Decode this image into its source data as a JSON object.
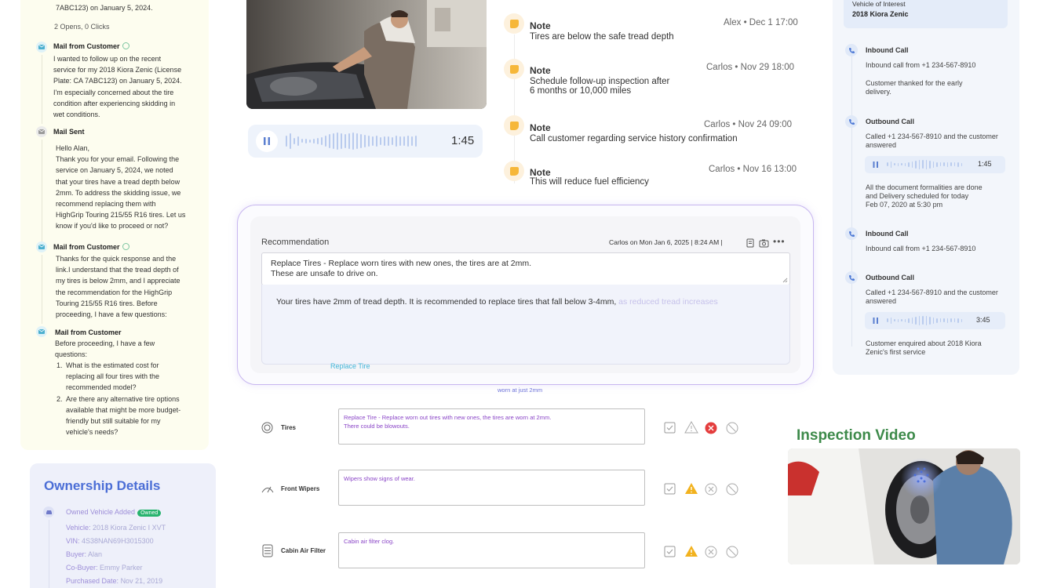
{
  "email_thread": {
    "top_snippet": "7ABC123) on January 5, 2024.",
    "stats": "2 Opens, 0 Clicks",
    "mails": [
      {
        "title": "Mail from Customer",
        "lines": [
          "I wanted to follow up on the recent",
          "service for my 2018 Kiora Zenic (License",
          "Plate: CA 7ABC123) on January 5, 2024.",
          "I'm especially concerned about the tire",
          "condition after experiencing skidding in",
          "wet conditions."
        ]
      },
      {
        "title": "Mail Sent",
        "lines": [
          "Hello Alan,",
          "Thank you for your email. Following the",
          "service on January 5, 2024, we noted",
          "that your tires have a tread depth below",
          "2mm. To address the skidding issue, we",
          "recommend replacing them with",
          "HighGrip Touring 215/55 R16 tires. Let us",
          "know if you'd like to proceed or not?"
        ]
      },
      {
        "title": "Mail from Customer",
        "lines": [
          "Thanks for the quick response and the",
          "link.I understand that the tread depth of",
          "my tires is below 2mm, and I appreciate",
          "the recommendation for the HighGrip",
          "Touring 215/55 R16 tires. Before",
          "proceeding, I have a few questions:"
        ]
      },
      {
        "title": "Mail from Customer",
        "intro": [
          "Before proceeding, I have a few",
          "questions:"
        ],
        "list": [
          [
            "1.",
            "What is the estimated cost for",
            "replacing all four tires with the",
            "recommended model?"
          ],
          [
            "2.",
            "Are there any alternative tire options",
            "available that might be more budget-",
            "friendly but still suitable for my",
            "vehicle's needs?"
          ]
        ]
      }
    ]
  },
  "ownership": {
    "title": "Ownership Details",
    "added_label": "Owned Vehicle Added",
    "badge": "Owned",
    "rows": [
      {
        "k": "Vehicle:",
        "v": "2018 Kiora Zenic I XVT"
      },
      {
        "k": "VIN:",
        "v": "4S38NAN69H3015300"
      },
      {
        "k": "Buyer:",
        "v": "Alan"
      },
      {
        "k": "Co-Buyer:",
        "v": "Emmy Parker"
      },
      {
        "k": "Purchased Date:",
        "v": "Nov 21, 2019"
      }
    ]
  },
  "audio": {
    "duration": "1:45"
  },
  "notes": [
    {
      "title": "Note",
      "body": "Tires are below the safe tread depth",
      "meta": "Alex • Dec 1 17:00"
    },
    {
      "title": "Note",
      "body": "Schedule follow-up inspection after\n6 months or 10,000 miles",
      "meta": "Carlos • Nov 29 18:00"
    },
    {
      "title": "Note",
      "body": "Call customer regarding service history confirmation",
      "meta": "Carlos • Nov 24 09:00"
    },
    {
      "title": "Note",
      "body": "This will reduce fuel efficiency",
      "meta": "Carlos • Nov 16 13:00"
    }
  ],
  "recommendation": {
    "label": "Recommendation",
    "meta": "Carlos on Mon Jan 6, 2025 | 8:24 AM |",
    "input_line1": "Replace Tires - Replace worn tires with new ones, the tires are at 2mm.",
    "input_line2": "These are unsafe to drive on.",
    "ai_text_dark": "Your tires have 2mm of tread depth. It is recommended to replace tires that fall below 3-4mm,",
    "ai_text_fade": " as reduced tread increases",
    "chip_tire": "Replace Tire",
    "chip_worn": "worn at just 2mm"
  },
  "inspection_rows": [
    {
      "label": "Tires",
      "text": "Replace Tire - Replace worn out tires with new ones, the tires are worn at 2mm.\nThere could be blowouts.",
      "status": "red"
    },
    {
      "label": "Front Wipers",
      "text": "Wipers show signs of wear.",
      "status": "yellow"
    },
    {
      "label": "Cabin Air Filter",
      "text": "Cabin air filter clog.",
      "status": "yellow"
    }
  ],
  "calls": {
    "voi_label": "Vehicle of Interest",
    "voi_value": "2018 Kiora Zenic",
    "items": [
      {
        "title": "Inbound Call",
        "text": "Inbound call from +1 234-567-8910",
        "note": "Customer thanked for the early\ndelivery."
      },
      {
        "title": "Outbound Call",
        "text": "Called +1 234-567-8910 and the customer\nanswered",
        "audio": "1:45",
        "note": "All the document formalities are done\nand Delivery scheduled for today\nFeb 07, 2020 at 5:30 pm"
      },
      {
        "title": "Inbound Call",
        "text": "Inbound call from +1 234-567-8910"
      },
      {
        "title": "Outbound Call",
        "text": "Called +1 234-567-8910 and the customer\nanswered",
        "audio": "3:45",
        "note": "Customer enquired about 2018 Kiora\nZenic's first service"
      }
    ]
  },
  "inspection_video": {
    "title": "Inspection Video"
  }
}
